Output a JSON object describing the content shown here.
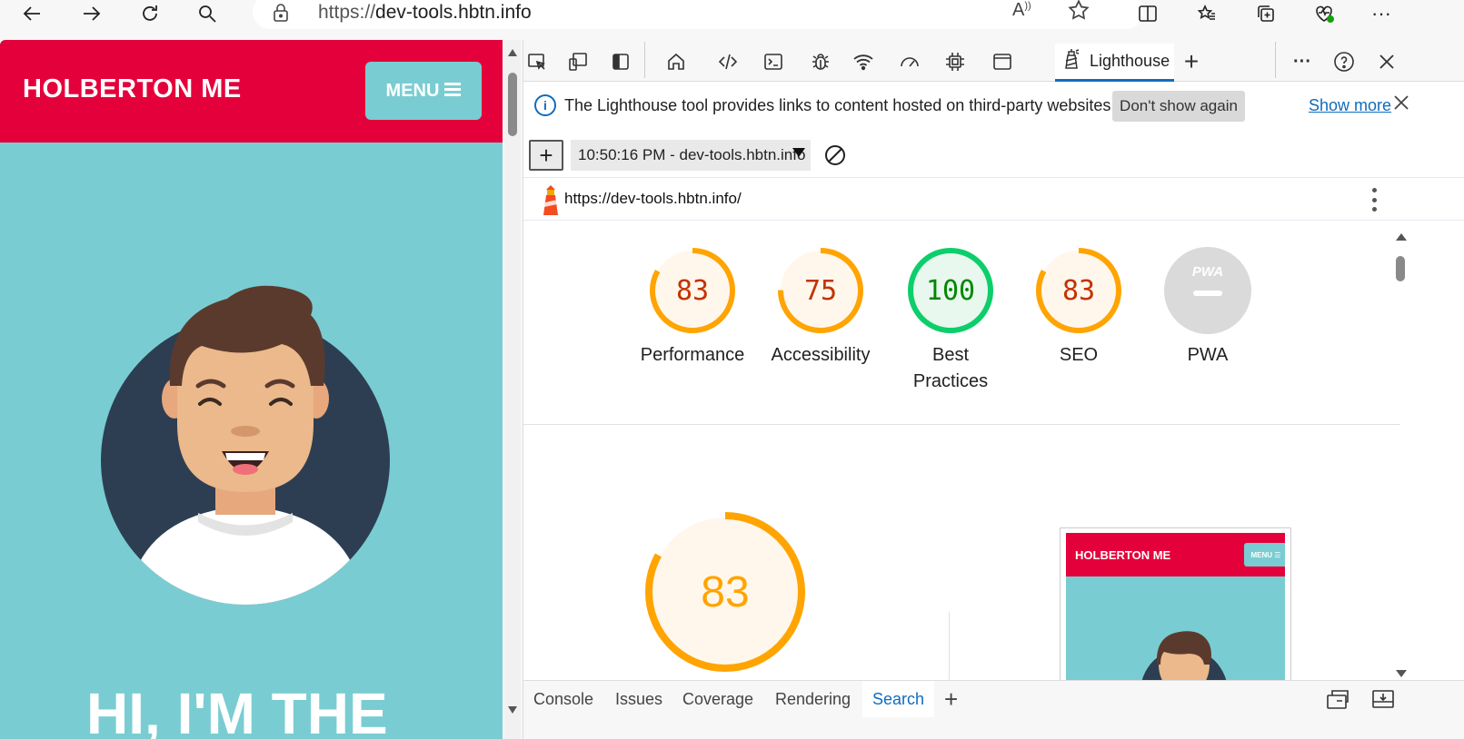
{
  "browser": {
    "url_prefix": "https://",
    "url_host": "dev-tools.hbtn.info"
  },
  "page": {
    "site_title": "HOLBERTON ME",
    "menu_label": "MENU",
    "hero_text": "HI, I'M THE"
  },
  "devtools": {
    "active_tab": "Lighthouse",
    "infobar": {
      "message": "The Lighthouse tool provides links to content hosted on third-party websites.",
      "dont_show": "Don't show again",
      "show_more": "Show more"
    },
    "report_select": "10:50:16 PM - dev-tools.hbtn.info",
    "report_url": "https://dev-tools.hbtn.info/",
    "scores": [
      {
        "label": "Performance",
        "value": "83",
        "color": "#ffa400"
      },
      {
        "label": "Accessibility",
        "value": "75",
        "color": "#ffa400"
      },
      {
        "label": "Best Practices",
        "value": "100",
        "color": "#0cce6b"
      },
      {
        "label": "SEO",
        "value": "83",
        "color": "#ffa400"
      },
      {
        "label": "PWA",
        "value": "PWA",
        "color": "#cccccc"
      }
    ],
    "big_score": "83",
    "thumbnail": {
      "title": "HOLBERTON ME",
      "menu": "MENU"
    },
    "drawer_tabs": [
      "Console",
      "Issues",
      "Coverage",
      "Rendering",
      "Search"
    ],
    "active_drawer_tab": "Search"
  },
  "colors": {
    "brand_red": "#e4003b",
    "brand_teal": "#79cdd2",
    "score_average": "#ffa400",
    "score_pass": "#0cce6b",
    "accent_blue": "#0f6cbd"
  }
}
